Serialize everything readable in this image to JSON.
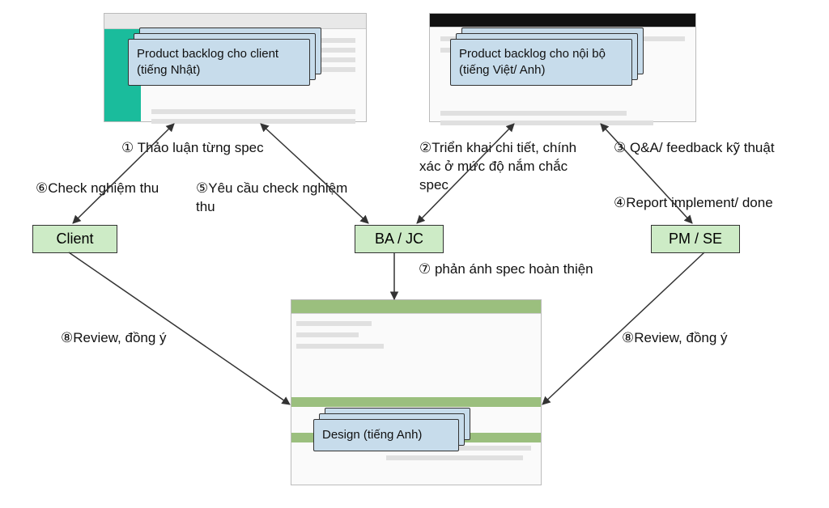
{
  "notes": {
    "client_backlog": "Product backlog cho client (tiếng Nhật)",
    "internal_backlog": "Product backlog cho nội bộ (tiếng Việt/ Anh)",
    "design": "Design (tiếng Anh)"
  },
  "roles": {
    "client": "Client",
    "ba_jc": "BA / JC",
    "pm_se": "PM / SE"
  },
  "labels": {
    "l1": "① Thảo luận từng spec",
    "l2": "②Triển khai chi tiết, chính xác ở mức độ nắm chắc spec",
    "l3": "③ Q&A/ feedback kỹ thuật",
    "l4": "④Report implement/ done",
    "l5": "⑤Yêu cầu check nghiệm thu",
    "l6": "⑥Check nghiệm thu",
    "l7": "⑦ phản ánh spec hoàn thiện",
    "l8a": "⑧Review, đồng ý",
    "l8b": "⑧Review, đồng ý"
  }
}
